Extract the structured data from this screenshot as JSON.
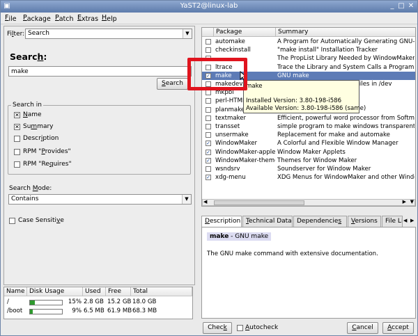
{
  "window": {
    "title": "YaST2@linux-lab"
  },
  "menu": [
    {
      "pre": "",
      "u": "F",
      "post": "ile"
    },
    {
      "pre": "",
      "u": "P",
      "post": "ackage"
    },
    {
      "pre": "",
      "u": "P",
      "post": "atch"
    },
    {
      "pre": "",
      "u": "E",
      "post": "xtras"
    },
    {
      "pre": "",
      "u": "H",
      "post": "elp"
    }
  ],
  "filter": {
    "label_pre": "Fi",
    "label_u": "l",
    "label_post": "ter:",
    "value": "Search"
  },
  "search": {
    "heading_pre": "Searc",
    "heading_u": "h",
    "heading_post": ":",
    "input_value": "make",
    "button_pre": "",
    "button_u": "S",
    "button_post": "earch"
  },
  "search_in": {
    "legend": "Search in",
    "options": [
      {
        "pre": "",
        "u": "N",
        "post": "ame",
        "checked": true
      },
      {
        "pre": "Su",
        "u": "m",
        "post": "mary",
        "checked": true
      },
      {
        "pre": "Descr",
        "u": "i",
        "post": "ption",
        "checked": false
      },
      {
        "pre": "RPM \"",
        "u": "P",
        "post": "rovides\"",
        "checked": false
      },
      {
        "pre": "RPM \"Re",
        "u": "q",
        "post": "uires\"",
        "checked": false
      }
    ]
  },
  "search_mode": {
    "label_pre": "Search ",
    "label_u": "M",
    "label_post": "ode:",
    "value": "Contains"
  },
  "case_sensitive": {
    "pre": "Case Sensiti",
    "u": "v",
    "post": "e",
    "checked": false
  },
  "disk": {
    "headers": [
      "Name",
      "Disk Usage",
      "Used",
      "Free",
      "Total"
    ],
    "rows": [
      {
        "name": "/",
        "pct": "15%",
        "fill": 0.15,
        "used": "2.8 GB",
        "free": "15.2 GB",
        "total": "18.0 GB"
      },
      {
        "name": "/boot",
        "pct": "9%",
        "fill": 0.09,
        "used": "6.5 MB",
        "free": "61.9 MB",
        "total": "68.3 MB"
      }
    ]
  },
  "packages": {
    "headers": [
      "Package",
      "Summary"
    ],
    "rows": [
      {
        "name": "automake",
        "summary": "A Program for Automatically Generating GNU-Style",
        "checked": false
      },
      {
        "name": "checkinstall",
        "summary": "\"make install\" Installation Tracker",
        "checked": false
      },
      {
        "name": "",
        "summary": "The PropList Library Needed by WindowMaker an",
        "checked": false
      },
      {
        "name": "ltrace",
        "summary": "Trace the Library and System Calls a Program M",
        "checked": false
      },
      {
        "name": "make",
        "summary": "GNU make",
        "checked": true,
        "selected": true
      },
      {
        "name": "makedev",
        "summary": "Script for Creating Device Files in /dev",
        "checked": false
      },
      {
        "name": "mkpbi",
        "summary": "k",
        "checked": false
      },
      {
        "name": "perl-HTML-",
        "summary": "using HTML Templ",
        "checked": false
      },
      {
        "name": "planmaker",
        "summary": "adsheet",
        "checked": false
      },
      {
        "name": "textmaker",
        "summary": "Efficient, powerful word processor from Softmake",
        "checked": false
      },
      {
        "name": "transset",
        "summary": "simple program to make windows transparent",
        "checked": false
      },
      {
        "name": "unsermake",
        "summary": "Replacement for make and automake",
        "checked": false
      },
      {
        "name": "WindowMaker",
        "summary": "A Colorful and Flexible Window Manager",
        "checked": true
      },
      {
        "name": "WindowMaker-applets",
        "summary": "Window Maker Applets",
        "checked": true
      },
      {
        "name": "WindowMaker-themes",
        "summary": "Themes for Window Maker",
        "checked": true
      },
      {
        "name": "wsndsrv",
        "summary": "Soundserver for Window Maker",
        "checked": false
      },
      {
        "name": "xdg-menu",
        "summary": "XDG Menus for WindowMaker and other Window",
        "checked": true
      }
    ]
  },
  "tooltip": {
    "title": "make",
    "installed": "Installed Version: 3.80-198-i586",
    "available": "Available Version: 3.80-198-i586 (same)"
  },
  "tabs": [
    {
      "pre": "",
      "u": "D",
      "post": "escription",
      "active": true
    },
    {
      "pre": "",
      "u": "T",
      "post": "echnical Data",
      "active": false
    },
    {
      "pre": "Dependencie",
      "u": "s",
      "post": "",
      "active": false
    },
    {
      "pre": "",
      "u": "V",
      "post": "ersions",
      "active": false
    },
    {
      "pre": "File L",
      "u": "",
      "post": "i",
      "active": false
    }
  ],
  "description": {
    "name": "make",
    "summary": " - GNU make",
    "body": "The GNU make command with extensive documentation."
  },
  "bottom": {
    "check": {
      "pre": "Chec",
      "u": "k",
      "post": ""
    },
    "autocheck": {
      "pre": "",
      "u": "A",
      "post": "utocheck"
    },
    "cancel": {
      "pre": "",
      "u": "C",
      "post": "ancel"
    },
    "accept": {
      "pre": "",
      "u": "A",
      "post": "ccept"
    }
  },
  "icons": {
    "close": "close-icon",
    "maximize": "maximize-icon",
    "minimize": "minimize-icon",
    "app": "yast-icon"
  }
}
